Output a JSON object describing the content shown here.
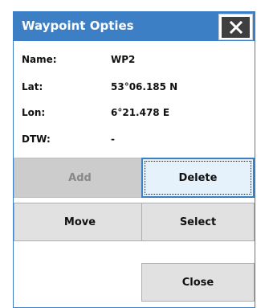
{
  "dialog": {
    "title": "Waypoint Opties",
    "accent_color": "#3d7fc4",
    "close_icon": "close-icon"
  },
  "fields": [
    {
      "label": "Name:",
      "value": "WP2"
    },
    {
      "label": "Lat:",
      "value": "53°06.185 N"
    },
    {
      "label": "Lon:",
      "value": "6°21.478 E"
    },
    {
      "label": "DTW:",
      "value": "-"
    }
  ],
  "buttons": {
    "add": "Add",
    "delete": "Delete",
    "move": "Move",
    "select": "Select",
    "close": "Close"
  }
}
